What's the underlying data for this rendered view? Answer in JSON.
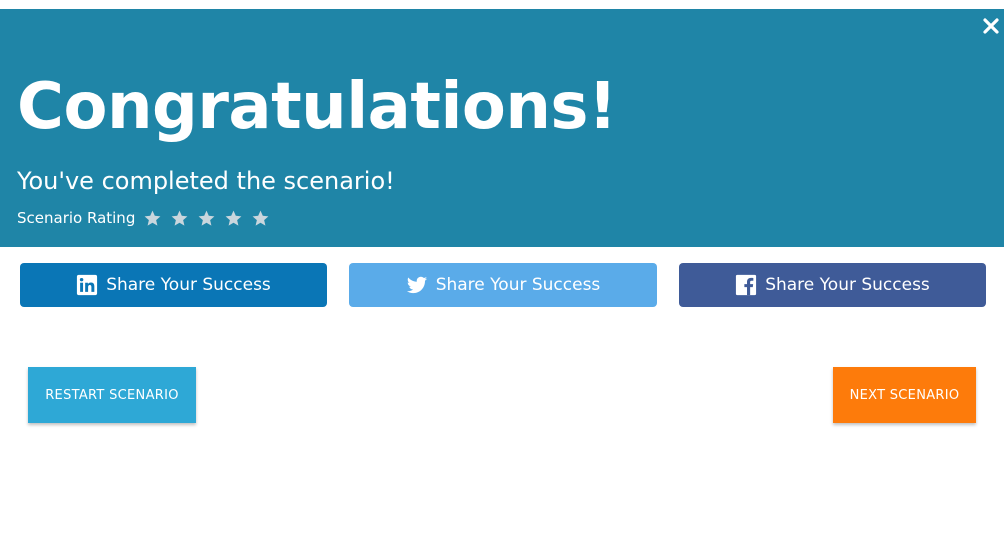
{
  "header": {
    "title": "Congratulations!",
    "subtitle": "You've completed the scenario!",
    "rating_label": "Scenario Rating",
    "rating_stars_total": 5,
    "rating_stars_filled": 0,
    "background_color": "#1f85a7",
    "close_icon": "close-icon"
  },
  "share": {
    "linkedin": {
      "label": "Share Your Success",
      "icon": "linkedin-icon",
      "color": "#0a76b6"
    },
    "twitter": {
      "label": "Share Your Success",
      "icon": "twitter-icon",
      "color": "#5aabe9"
    },
    "facebook": {
      "label": "Share Your Success",
      "icon": "facebook-icon",
      "color": "#3f5b98"
    }
  },
  "actions": {
    "restart_label": "RESTART SCENARIO",
    "restart_color": "#2ea8d6",
    "next_label": "NEXT SCENARIO",
    "next_color": "#fd7b0b"
  }
}
